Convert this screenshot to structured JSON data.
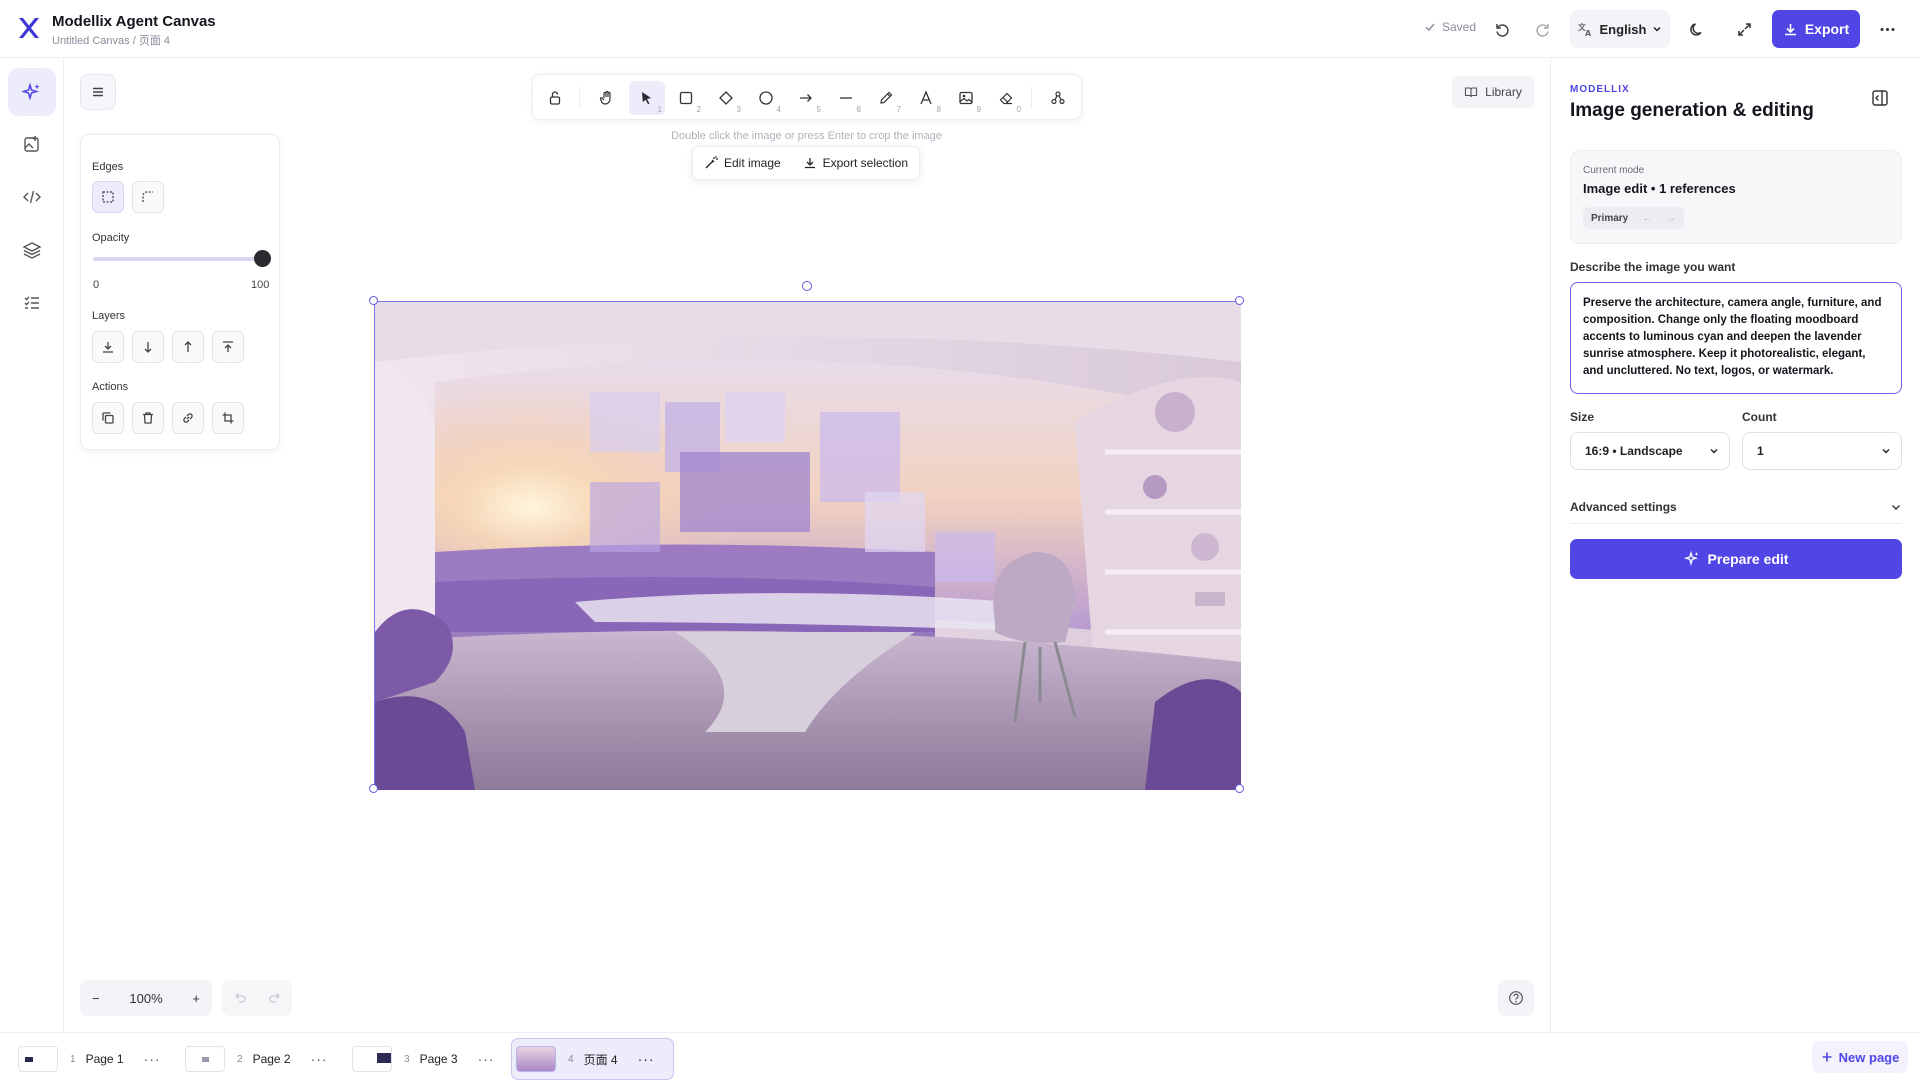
{
  "app": {
    "title": "Modellix Agent Canvas",
    "breadcrumb": "Untitled Canvas / 页面 4"
  },
  "header": {
    "saved": "Saved",
    "language": "English",
    "export": "Export"
  },
  "canvas_ui": {
    "hint": "Double click the image or press Enter to crop the image",
    "context_menu": {
      "edit": "Edit image",
      "export": "Export selection"
    },
    "library": "Library",
    "tool_keys": [
      "1",
      "2",
      "3",
      "4",
      "5",
      "6",
      "7",
      "8",
      "9",
      "0"
    ]
  },
  "properties": {
    "edges": "Edges",
    "opacity": "Opacity",
    "opacity_min": "0",
    "opacity_max": "100",
    "opacity_value": 100,
    "layers": "Layers",
    "actions": "Actions"
  },
  "zoom": {
    "value": "100%",
    "minus": "−",
    "plus": "+"
  },
  "panel": {
    "brand": "MODELLIX",
    "title": "Image generation & editing",
    "current_mode_label": "Current mode",
    "current_mode_value": "Image edit • 1 references",
    "primary_chip": "Primary",
    "describe_label": "Describe the image you want",
    "prompt": "Preserve the architecture, camera angle, furniture, and composition. Change only the floating moodboard accents to luminous cyan and deepen the lavender sunrise atmosphere. Keep it photorealistic, elegant, and uncluttered. No text, logos, or watermark.",
    "size_label": "Size",
    "size_value": "16:9 • Landscape",
    "count_label": "Count",
    "count_value": "1",
    "advanced": "Advanced settings",
    "prepare": "Prepare edit"
  },
  "pages": [
    {
      "num": "1",
      "name": "Page 1"
    },
    {
      "num": "2",
      "name": "Page 2"
    },
    {
      "num": "3",
      "name": "Page 3"
    },
    {
      "num": "4",
      "name": "页面 4"
    }
  ],
  "new_page": "New page",
  "colors": {
    "accent": "#5046e5",
    "accent_soft": "#ececfb"
  }
}
